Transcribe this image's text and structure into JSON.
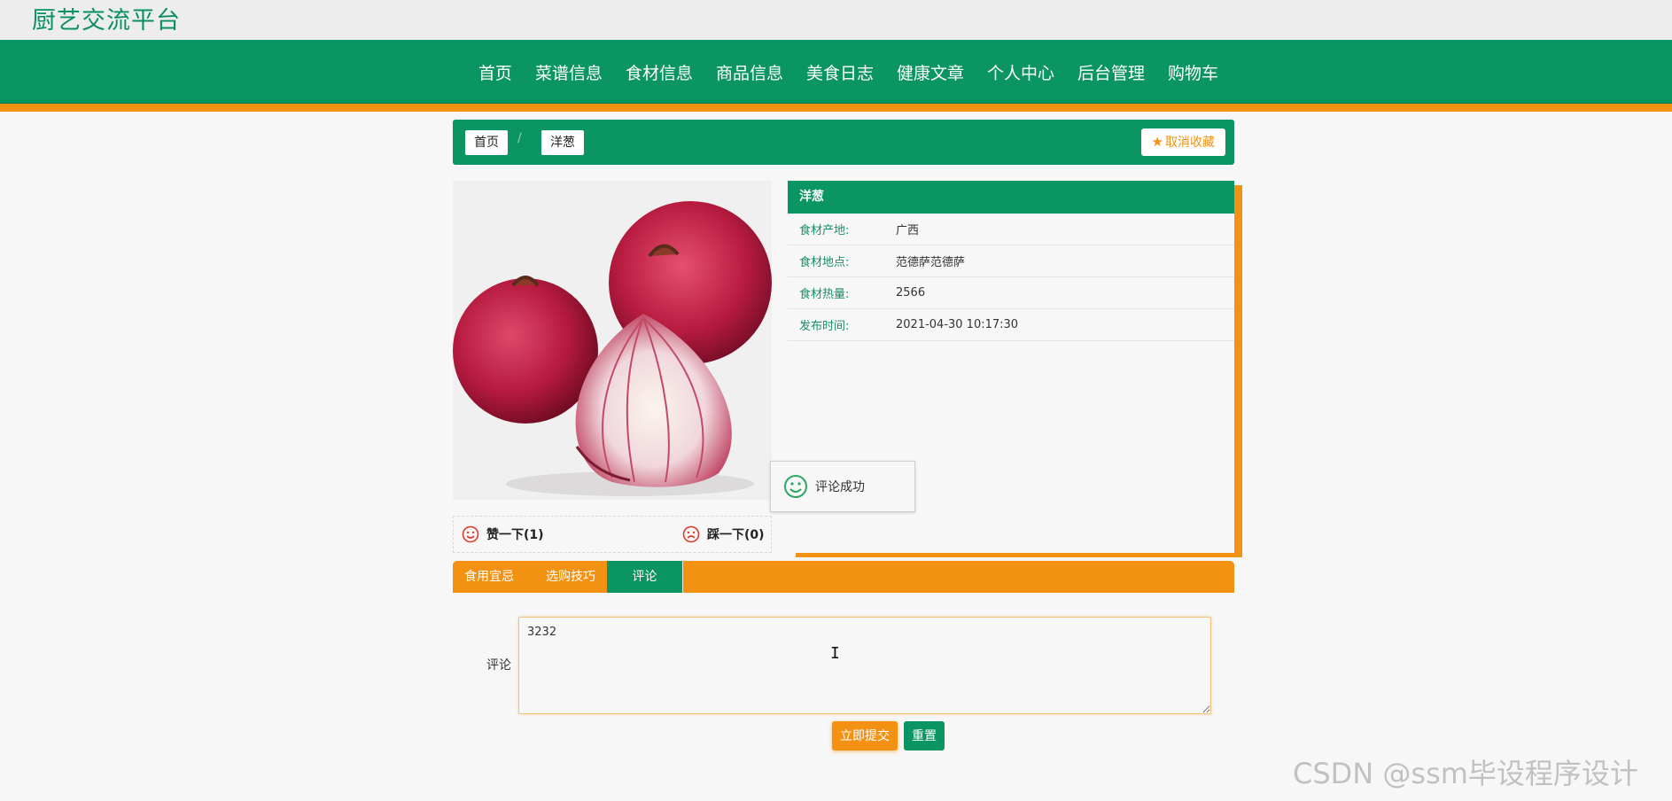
{
  "site": {
    "title": "厨艺交流平台"
  },
  "nav": {
    "items": [
      "首页",
      "菜谱信息",
      "食材信息",
      "商品信息",
      "美食日志",
      "健康文章",
      "个人中心",
      "后台管理",
      "购物车"
    ]
  },
  "breadcrumb": {
    "home": "首页",
    "separator": "/",
    "current": "洋葱",
    "favorite_label": "取消收藏"
  },
  "ingredient": {
    "name": "洋葱",
    "fields": [
      {
        "label": "食材产地:",
        "value": "广西"
      },
      {
        "label": "食材地点:",
        "value": "范德萨范德萨"
      },
      {
        "label": "食材热量:",
        "value": "2566"
      },
      {
        "label": "发布时间:",
        "value": "2021-04-30 10:17:30"
      }
    ]
  },
  "votes": {
    "like_label": "赞一下(1)",
    "dislike_label": "踩一下(0)"
  },
  "toast": {
    "message": "评论成功"
  },
  "tabs": [
    {
      "label": "食用宜忌",
      "active": false
    },
    {
      "label": "选购技巧",
      "active": false
    },
    {
      "label": "评论",
      "active": true
    }
  ],
  "comment": {
    "label": "评论",
    "value": "3232",
    "submit_label": "立即提交",
    "reset_label": "重置"
  },
  "watermark": "CSDN @ssm毕设程序设计",
  "colors": {
    "brand_green": "#0a9562",
    "accent_orange": "#f39212",
    "like_icon": "#e23b2e",
    "toast_icon": "#2ba862"
  },
  "icons": {
    "favorite": "star-icon",
    "like": "smile-icon",
    "dislike": "frown-icon",
    "toast": "smile-icon"
  }
}
